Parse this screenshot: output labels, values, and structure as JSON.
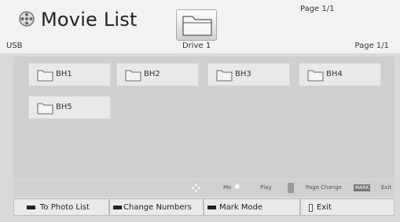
{
  "header": {
    "title": "Movie List",
    "page_top": "Page 1/1",
    "location": "USB",
    "drive": "Drive 1",
    "page_right": "Page 1/1"
  },
  "folders": [
    "BH1",
    "BH2",
    "BH3",
    "BH4",
    "BH5"
  ],
  "hints": {
    "move": "Mo",
    "play": "Play",
    "page_change": "Page Change",
    "mark": "MARK",
    "exit": "Exit"
  },
  "buttons": {
    "photo_list": "To Photo List",
    "change_numbers": "Change Numbers",
    "mark_mode": "Mark Mode",
    "exit": "Exit"
  },
  "icons": {
    "app": "film-reel-icon",
    "drive": "folder-icon",
    "navigate": "navigate-arrows-icon",
    "page": "page-up-down-icon"
  },
  "colors": {
    "panel": "#cfcfcf",
    "folder_tile": "#e9e9e9",
    "header": "#f2f2f2",
    "button": "#eaeaea"
  }
}
